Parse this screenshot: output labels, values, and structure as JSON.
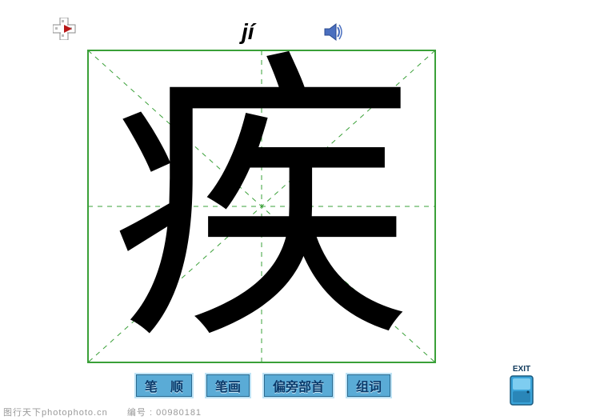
{
  "pinyin": "jí",
  "character": "疾",
  "buttons": {
    "stroke_order": "笔 顺",
    "strokes": "笔画",
    "radical": "偏旁部首",
    "words": "组词"
  },
  "exit": {
    "label": "EXIT"
  },
  "footer": {
    "site": "图行天下photophoto.cn",
    "id_label": "编号",
    "id_value": "00980181"
  },
  "icons": {
    "corner": "cross-red-icon",
    "speaker": "speaker-icon",
    "exit_door": "exit-door-icon"
  }
}
